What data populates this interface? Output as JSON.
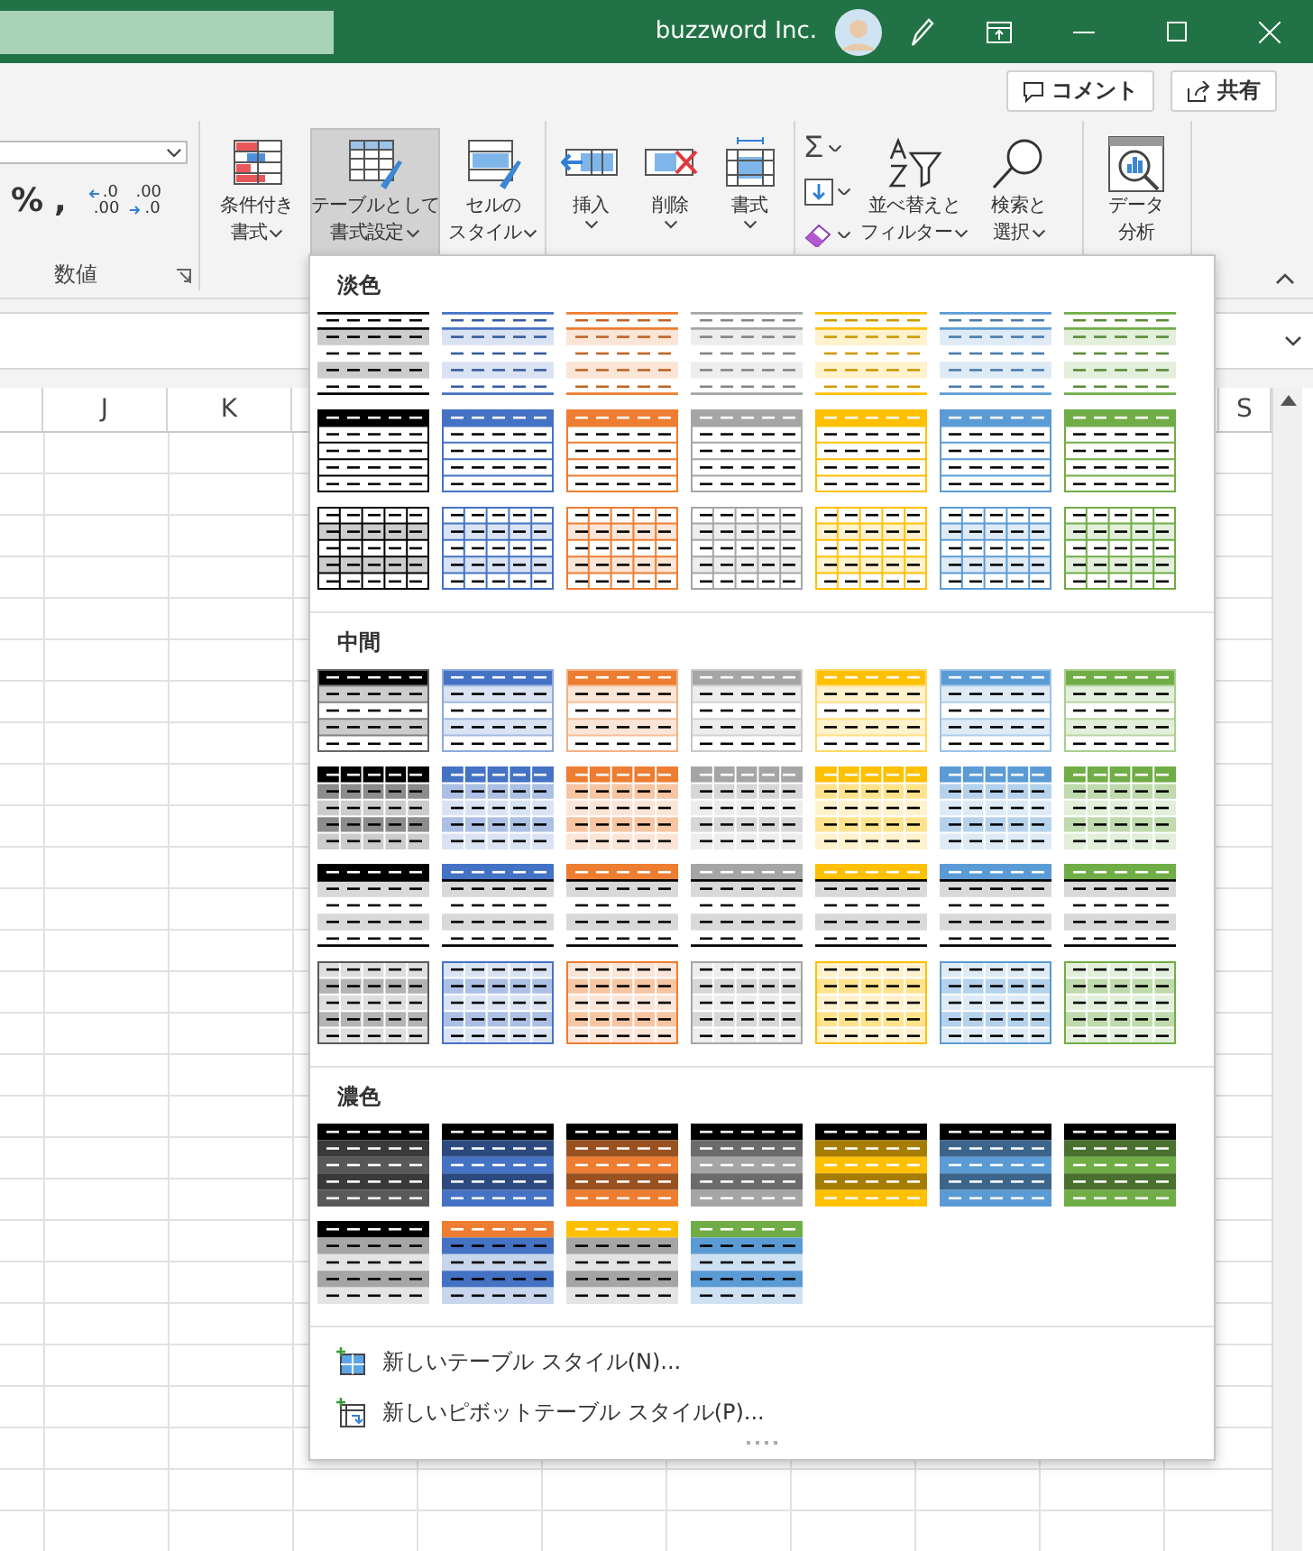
{
  "title_bar": {
    "account_name": "buzzword Inc."
  },
  "ribbon": {
    "comment_button": "コメント",
    "share_button": "共有",
    "number_group": {
      "label": "数値",
      "percent": "%",
      "comma": ",",
      "increase_decimal": [
        ".0",
        ".00"
      ],
      "decrease_decimal": [
        ".00",
        ".0"
      ]
    },
    "style_buttons": [
      {
        "kind": "conditional",
        "lines": [
          "条件付き",
          "書式"
        ],
        "selected": false
      },
      {
        "kind": "table",
        "lines": [
          "テーブルとして",
          "書式設定"
        ],
        "selected": true
      },
      {
        "kind": "cell-styles",
        "lines": [
          "セルの",
          "スタイル"
        ],
        "selected": false
      }
    ],
    "cell_buttons": [
      {
        "kind": "insert",
        "lines": [
          "挿入"
        ],
        "selected": false
      },
      {
        "kind": "delete",
        "lines": [
          "削除"
        ],
        "selected": false
      },
      {
        "kind": "format",
        "lines": [
          "書式"
        ],
        "selected": false
      }
    ],
    "autosum": "Σ",
    "edit_buttons": [
      {
        "kind": "sort",
        "lines": [
          "並べ替えと",
          "フィルター"
        ],
        "selected": false
      },
      {
        "kind": "find",
        "lines": [
          "検索と",
          "選択"
        ],
        "selected": false
      }
    ],
    "analysis_button": {
      "kind": "analysis",
      "lines": [
        "データ",
        "分析"
      ],
      "selected": false
    }
  },
  "sheet": {
    "columns": [
      "J",
      "K",
      "S"
    ]
  },
  "gallery": {
    "sections": [
      {
        "title": "淡色",
        "rows": [
          {
            "kind": "light-banded",
            "swatches": [
              {
                "color": "#000000"
              },
              {
                "color": "#4472c4"
              },
              {
                "color": "#ed7d31"
              },
              {
                "color": "#a5a5a5"
              },
              {
                "color": "#ffc000"
              },
              {
                "color": "#5b9bd5"
              },
              {
                "color": "#70ad47"
              }
            ]
          },
          {
            "kind": "light-header",
            "swatches": [
              {
                "color": "#000000"
              },
              {
                "color": "#4472c4"
              },
              {
                "color": "#ed7d31"
              },
              {
                "color": "#a5a5a5"
              },
              {
                "color": "#ffc000"
              },
              {
                "color": "#5b9bd5"
              },
              {
                "color": "#70ad47"
              }
            ]
          },
          {
            "kind": "light-grid",
            "swatches": [
              {
                "color": "#000000"
              },
              {
                "color": "#4472c4"
              },
              {
                "color": "#ed7d31"
              },
              {
                "color": "#a5a5a5"
              },
              {
                "color": "#ffc000"
              },
              {
                "color": "#5b9bd5"
              },
              {
                "color": "#70ad47"
              }
            ]
          }
        ]
      },
      {
        "title": "中間",
        "rows": [
          {
            "kind": "medium-banded",
            "swatches": [
              {
                "color": "#000000"
              },
              {
                "color": "#4472c4"
              },
              {
                "color": "#ed7d31"
              },
              {
                "color": "#a5a5a5"
              },
              {
                "color": "#ffc000"
              },
              {
                "color": "#5b9bd5"
              },
              {
                "color": "#70ad47"
              }
            ]
          },
          {
            "kind": "medium-grid",
            "swatches": [
              {
                "color": "#000000"
              },
              {
                "color": "#4472c4"
              },
              {
                "color": "#ed7d31"
              },
              {
                "color": "#a5a5a5"
              },
              {
                "color": "#ffc000"
              },
              {
                "color": "#5b9bd5"
              },
              {
                "color": "#70ad47"
              }
            ]
          },
          {
            "kind": "medium-top",
            "swatches": [
              {
                "color": "#000000"
              },
              {
                "color": "#4472c4"
              },
              {
                "color": "#ed7d31"
              },
              {
                "color": "#a5a5a5"
              },
              {
                "color": "#ffc000"
              },
              {
                "color": "#5b9bd5"
              },
              {
                "color": "#70ad47"
              }
            ]
          },
          {
            "kind": "medium-tint-grid",
            "swatches": [
              {
                "color": "#595959"
              },
              {
                "color": "#4472c4"
              },
              {
                "color": "#ed7d31"
              },
              {
                "color": "#a5a5a5"
              },
              {
                "color": "#ffc000"
              },
              {
                "color": "#5b9bd5"
              },
              {
                "color": "#70ad47"
              }
            ]
          }
        ]
      },
      {
        "title": "濃色",
        "rows": [
          {
            "kind": "dark",
            "swatches": [
              {
                "color": "#595959"
              },
              {
                "color": "#4472c4"
              },
              {
                "color": "#ed7d31"
              },
              {
                "color": "#a5a5a5"
              },
              {
                "color": "#ffc000"
              },
              {
                "color": "#5b9bd5"
              },
              {
                "color": "#70ad47"
              }
            ]
          },
          {
            "kind": "dark-alt",
            "swatches": [
              {
                "color": "#000000",
                "band": {
                  "color": "#a5a5a5"
                }
              },
              {
                "color": "#ed7d31",
                "band": {
                  "color": "#4472c4"
                }
              },
              {
                "color": "#ffc000",
                "band": {
                  "color": "#a5a5a5"
                }
              },
              {
                "color": "#70ad47",
                "band": {
                  "color": "#5b9bd5"
                }
              }
            ]
          }
        ]
      }
    ],
    "menu_items": [
      {
        "kind": "table",
        "label": "新しいテーブル スタイル(N)..."
      },
      {
        "kind": "pivot",
        "label": "新しいピボットテーブル スタイル(P)..."
      }
    ]
  }
}
